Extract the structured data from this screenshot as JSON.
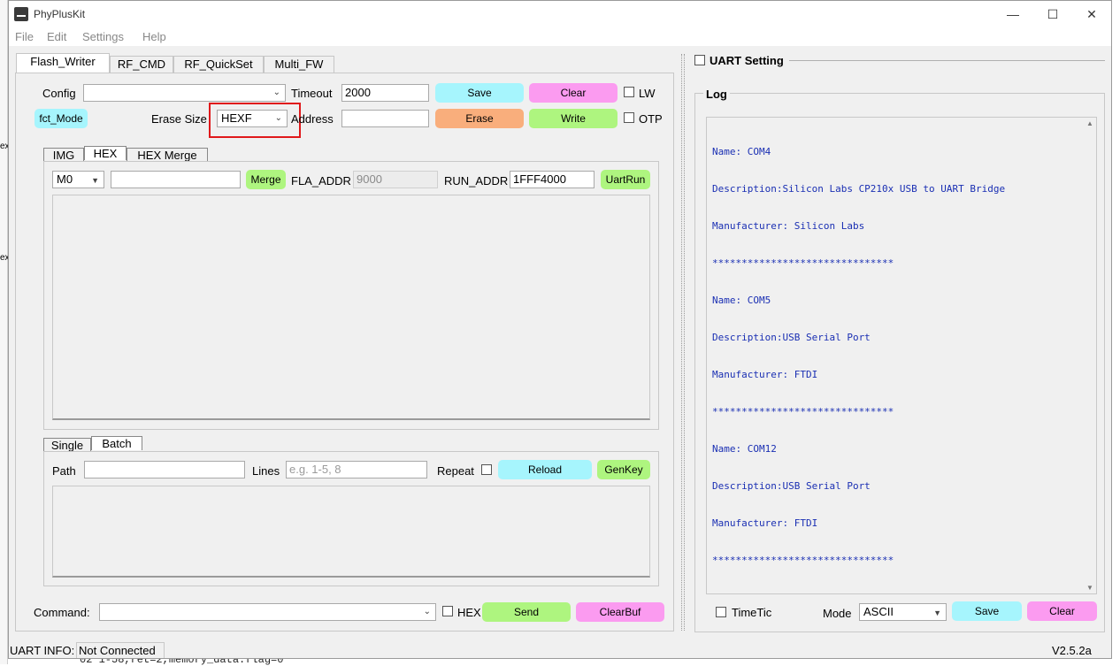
{
  "background_strip": {
    "text_1": "ex",
    "text_2": "ex"
  },
  "window": {
    "title": "PhyPlusKit",
    "minimize_glyph": "—",
    "maximize_glyph": "☐",
    "close_glyph": "✕"
  },
  "menu": {
    "file": "File",
    "edit": "Edit",
    "settings": "Settings",
    "help": "Help"
  },
  "tabs": {
    "flash_writer": "Flash_Writer",
    "rf_cmd": "RF_CMD",
    "rf_quickset": "RF_QuickSet",
    "multi_fw": "Multi_FW"
  },
  "flash": {
    "config_label": "Config",
    "config_value": "",
    "timeout_label": "Timeout",
    "timeout_value": "2000",
    "save": "Save",
    "clear": "Clear",
    "lw_label": "LW",
    "fct_mode": "fct_Mode",
    "erase_size_label": "Erase Size",
    "erase_size_value": "HEXF",
    "address_label": "Address",
    "address_value": "",
    "erase": "Erase",
    "write": "Write",
    "otp_label": "OTP"
  },
  "mode_tabs": {
    "img": "IMG",
    "hex": "HEX",
    "hex_merge": "HEX Merge"
  },
  "hex": {
    "core_value": "M0",
    "file_value": "",
    "merge": "Merge",
    "fla_addr_label": "FLA_ADDR",
    "fla_addr_value": "9000",
    "run_addr_label": "RUN_ADDR",
    "run_addr_value": "1FFF4000",
    "uartrun": "UartRun"
  },
  "batch_tabs": {
    "single": "Single",
    "batch": "Batch"
  },
  "batch": {
    "path_label": "Path",
    "path_value": "",
    "lines_label": "Lines",
    "lines_placeholder": "e.g. 1-5, 8",
    "repeat_label": "Repeat",
    "reload": "Reload",
    "genkey": "GenKey"
  },
  "command": {
    "label": "Command:",
    "value": "",
    "hex_label": "HEX",
    "send": "Send",
    "clearbuf": "ClearBuf"
  },
  "status": {
    "uart_info_label": "UART INFO:",
    "uart_info_value": "Not Connected",
    "version": "V2.5.2a"
  },
  "right": {
    "uart_setting": "UART Setting",
    "log_title": "Log",
    "log_lines": [
      "Name: COM4",
      "Description:Silicon Labs CP210x USB to UART Bridge",
      "Manufacturer: Silicon Labs",
      "*******************************",
      "Name: COM5",
      "Description:USB Serial Port",
      "Manufacturer: FTDI",
      "*******************************",
      "Name: COM12",
      "Description:USB Serial Port",
      "Manufacturer: FTDI",
      "*******************************"
    ],
    "timetic_label": "TimeTic",
    "mode_label": "Mode",
    "mode_value": "ASCII",
    "save": "Save",
    "clear": "Clear"
  },
  "underlying_text": "02 1-58,ret=2,memory_data.flag=0",
  "colors": {
    "cyan": "#a6f5fd",
    "pink": "#fb9bf0",
    "orange": "#f9ae7c",
    "green": "#aef57f",
    "log_text": "#1a2fb3",
    "highlight": "#e0191b"
  }
}
